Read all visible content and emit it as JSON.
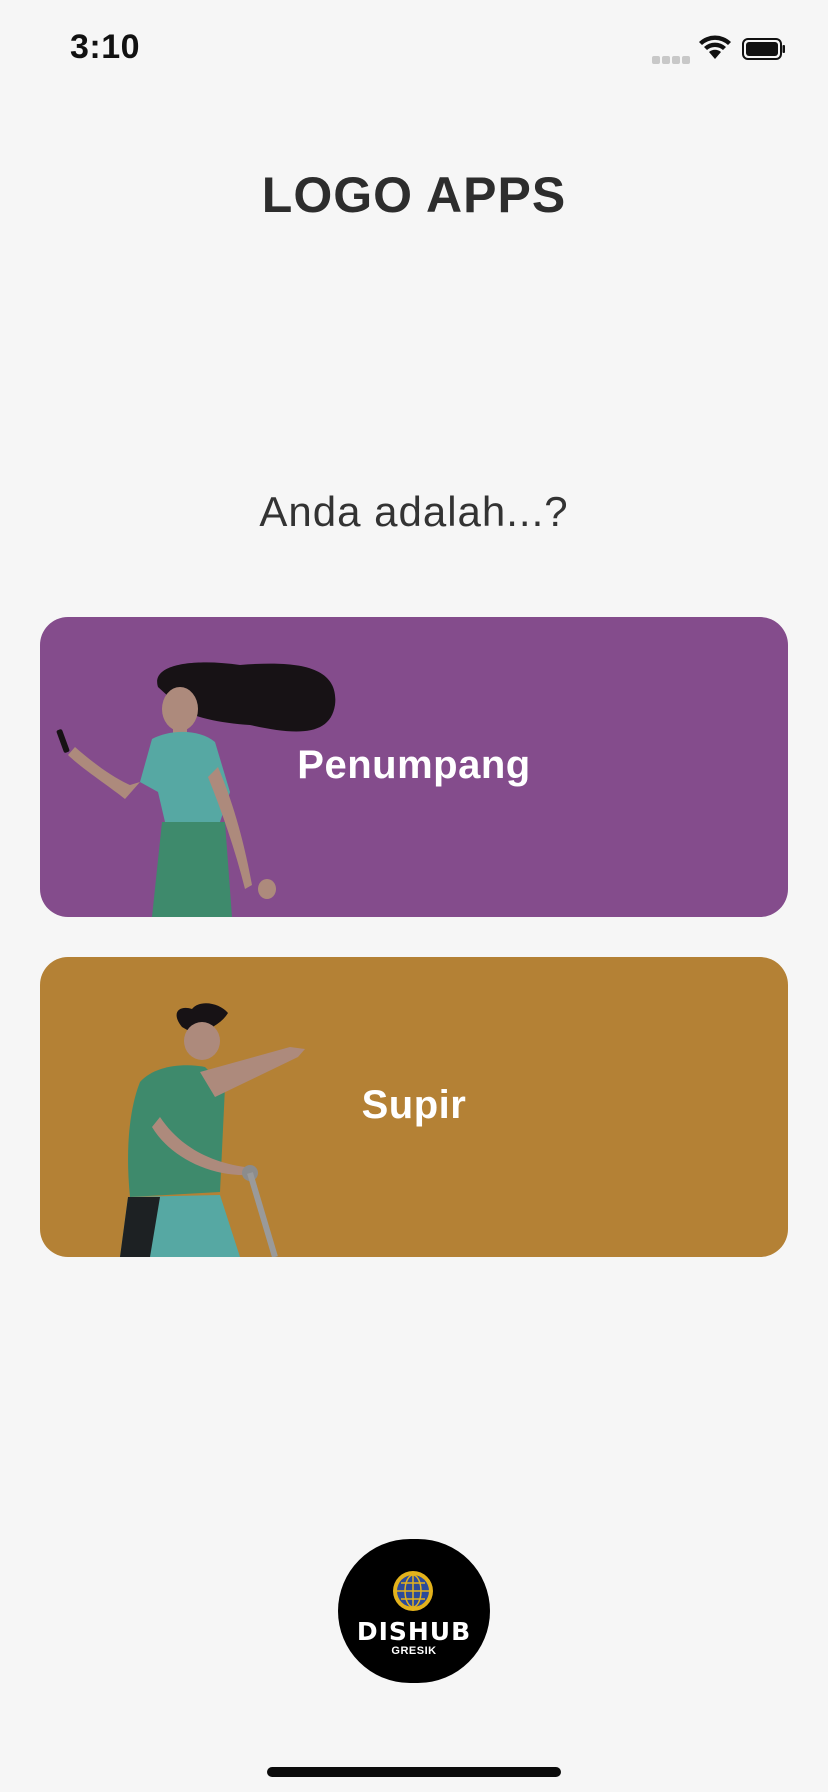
{
  "status_bar": {
    "time": "3:10",
    "icons": [
      "cellular-signal-icon",
      "wifi-icon",
      "battery-icon"
    ]
  },
  "header": {
    "title": "LOGO APPS"
  },
  "prompt": {
    "question": "Anda adalah...?"
  },
  "roles": [
    {
      "label": "Penumpang",
      "color": "#844c8c",
      "illustration": "woman-with-phone-illustration"
    },
    {
      "label": "Supir",
      "color": "#b48135",
      "illustration": "man-pointing-driver-illustration"
    }
  ],
  "footer": {
    "logo_text": "DISHUB",
    "logo_subtext": "GRESIK",
    "logo_icon": "globe-emblem-icon"
  },
  "colors": {
    "background": "#f6f6f6",
    "penumpang_card": "#844c8c",
    "supir_card": "#b48135",
    "text_dark": "#2d2d2d"
  }
}
